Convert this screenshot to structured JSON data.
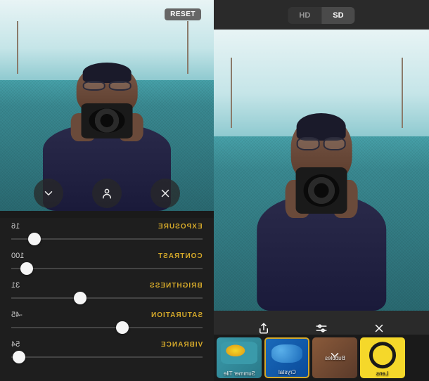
{
  "left": {
    "reset_label": "RESET",
    "buttons": {
      "expand": "expand",
      "person": "person",
      "close": "close"
    },
    "adjustments": [
      {
        "label": "EXPOSURE",
        "value": "16",
        "pos": 12
      },
      {
        "label": "CONTRAST",
        "value": "100",
        "pos": 8
      },
      {
        "label": "BRIGHTNESS",
        "value": "31",
        "pos": 36
      },
      {
        "label": "SATURATION",
        "value": "-45",
        "pos": 58
      },
      {
        "label": "VIBRANCE",
        "value": "54",
        "pos": 4
      }
    ]
  },
  "right": {
    "quality": {
      "hd": "HD",
      "sd": "SD",
      "active": "sd"
    },
    "tools": {
      "share": "share",
      "adjust": "adjust",
      "close": "close"
    },
    "filters": [
      {
        "name": "Summer Tile",
        "class": "ft-tile"
      },
      {
        "name": "Crystal",
        "class": "ft-crystal",
        "selected": true
      },
      {
        "name": "Bubbles",
        "class": "ft-bubbles"
      },
      {
        "name": "Lens",
        "class": "ft-lens"
      }
    ]
  }
}
